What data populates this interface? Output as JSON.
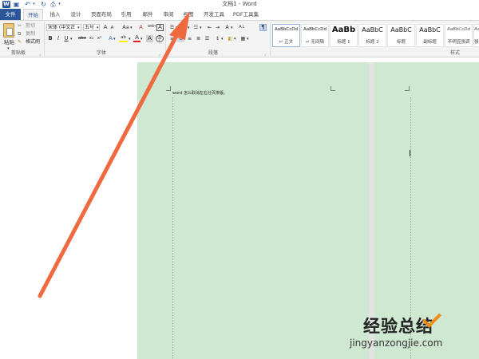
{
  "window": {
    "title": "文档1 - Word",
    "app_icon": "word-logo"
  },
  "quick_access": {
    "icons": [
      "save-icon",
      "undo-icon",
      "redo-icon",
      "print-preview-icon",
      "customize-icon"
    ]
  },
  "tabs": [
    {
      "label": "文件",
      "active": false
    },
    {
      "label": "开始",
      "active": true
    },
    {
      "label": "插入",
      "active": false
    },
    {
      "label": "设计",
      "active": false
    },
    {
      "label": "页面布局",
      "active": false
    },
    {
      "label": "引用",
      "active": false
    },
    {
      "label": "邮件",
      "active": false
    },
    {
      "label": "审阅",
      "active": false
    },
    {
      "label": "视图",
      "active": false
    },
    {
      "label": "开发工具",
      "active": false
    },
    {
      "label": "PDF工具集",
      "active": false
    }
  ],
  "clipboard": {
    "paste_label": "粘贴",
    "cut_label": "剪切",
    "copy_label": "复制",
    "format_painter_label": "格式刷",
    "group_label": "剪贴板"
  },
  "font": {
    "font_name": "宋体 (中文正",
    "font_size": "五号",
    "grow_label": "A",
    "shrink_label": "A",
    "case_label": "Aa",
    "clear_label": "A",
    "phonetic_label": "wén",
    "border_label": "A",
    "bold_label": "B",
    "italic_label": "I",
    "underline_label": "U",
    "strike_label": "abc",
    "sub_label": "x₂",
    "sup_label": "x²",
    "effects_label": "A",
    "highlight_label": "ab",
    "color_label": "A",
    "shade_label": "A",
    "circle_label": "字",
    "group_label": "字体"
  },
  "paragraph": {
    "group_label": "段落",
    "sort_label": "A↓",
    "marks_label": "¶"
  },
  "styles": {
    "group_label": "样式",
    "items": [
      {
        "sample": "AaBbCcDd",
        "name": "↵ 正文",
        "selected": true
      },
      {
        "sample": "AaBbCcDd",
        "name": "↵ 无间隔",
        "selected": false
      },
      {
        "sample": "AaBb",
        "name": "标题 1",
        "selected": false
      },
      {
        "sample": "AaBbC",
        "name": "标题 2",
        "selected": false
      },
      {
        "sample": "AaBbC",
        "name": "标题",
        "selected": false
      },
      {
        "sample": "AaBbC",
        "name": "副标题",
        "selected": false
      },
      {
        "sample": "AaBbCcDd",
        "name": "不明显强调",
        "selected": false
      },
      {
        "sample": "AaBbCcDd",
        "name": "强调",
        "selected": false
      }
    ]
  },
  "document": {
    "text": "word 怎么取消左右分页排版。"
  },
  "watermark": {
    "cn": "经验总结",
    "en": "jingyanzongjie.com"
  },
  "colors": {
    "brand": "#2b579a",
    "page_bg": "#cfe8d1",
    "arrow": "#f06a40",
    "watermark_accent": "#f08c1a"
  }
}
